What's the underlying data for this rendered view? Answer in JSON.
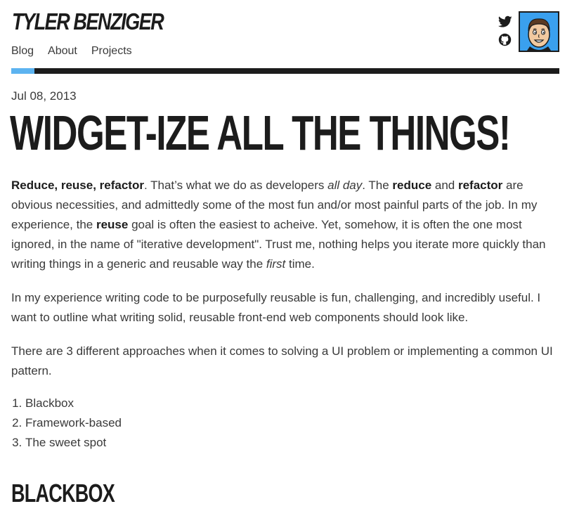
{
  "header": {
    "site_title": "TYLER BENZIGER",
    "nav": [
      "Blog",
      "About",
      "Projects"
    ],
    "social_icons": [
      "twitter-icon",
      "github-icon"
    ]
  },
  "post": {
    "date": "Jul 08, 2013",
    "title": "WIDGET-IZE ALL THE THINGS!",
    "p1": {
      "b1": "Reduce, reuse, refactor",
      "t1": ". That’s what we do as developers ",
      "i1": "all day",
      "t2": ". The ",
      "b2": "reduce",
      "t3": " and ",
      "b3": "refactor",
      "t4": " are obvious necessities, and admittedly some of the most fun and/or most painful parts of the job. In my experience, the ",
      "b4": "reuse",
      "t5": " goal is often the easiest to acheive. Yet, somehow, it is often the one most ignored, in the name of \"iterative development\". Trust me, nothing helps you iterate more quickly than writing things in a generic and reusable way the ",
      "i2": "first",
      "t6": " time."
    },
    "p2": "In my experience writing code to be purposefully reusable is fun, challenging, and incredibly useful. I want to outline what writing solid, reusable front-end web components should look like.",
    "p3": "There are 3 different approaches when it comes to solving a UI problem or implementing a common UI pattern.",
    "list": [
      "Blackbox",
      "Framework-based",
      "The sweet spot"
    ],
    "section_heading": "BLACKBOX"
  },
  "colors": {
    "accent": "#5cb3f0",
    "avatar_bg": "#3aa0ee",
    "text": "#3a3a3a",
    "dark": "#1c1c1c"
  }
}
